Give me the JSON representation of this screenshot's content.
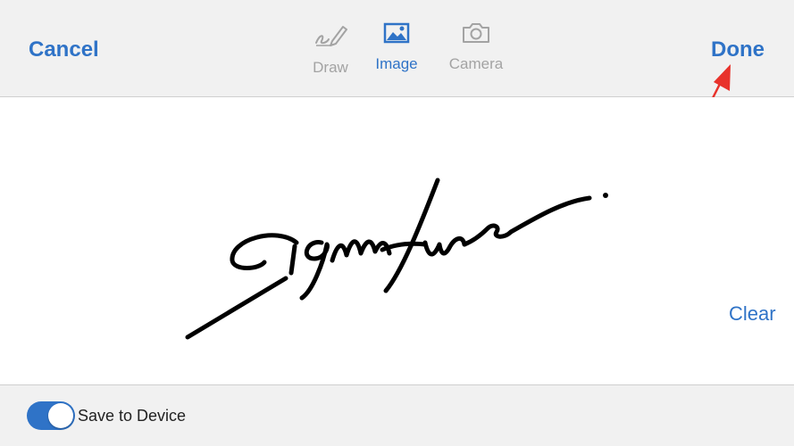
{
  "header": {
    "cancel_label": "Cancel",
    "done_label": "Done",
    "tabs": [
      {
        "label": "Draw",
        "icon": "pen-icon",
        "active": false
      },
      {
        "label": "Image",
        "icon": "image-icon",
        "active": true
      },
      {
        "label": "Camera",
        "icon": "camera-icon",
        "active": false
      }
    ]
  },
  "canvas": {
    "signature_text": "Signature",
    "clear_label": "Clear"
  },
  "footer": {
    "save_toggle_label": "Save to Device",
    "save_toggle_on": true
  },
  "colors": {
    "accent": "#2f73c7",
    "inactive": "#a3a3a3",
    "arrow": "#e8322b"
  }
}
